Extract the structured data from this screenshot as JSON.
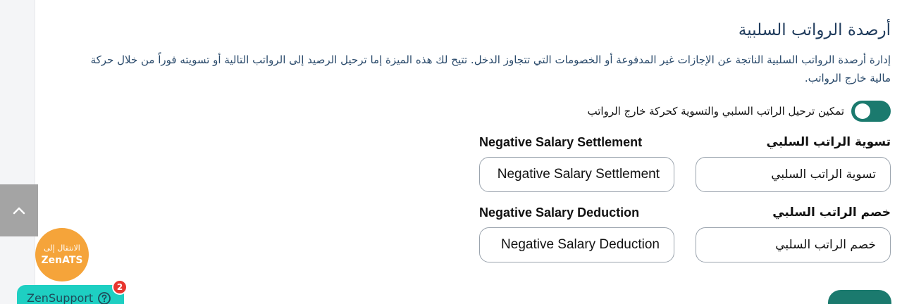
{
  "section": {
    "title": "أرصدة الرواتب السلبية",
    "description": "إدارة أرصدة الرواتب السلبية الناتجة عن الإجازات غير المدفوعة أو الخصومات التي تتجاوز الدخل. تتيح لك هذه الميزة إما ترحيل الرصيد إلى الرواتب التالية أو تسويته فوراً من خلال حركة مالية خارج الرواتب."
  },
  "toggle": {
    "label": "تمكين ترحيل الراتب السلبي والتسوية كحركة خارج الرواتب",
    "enabled": true
  },
  "fields": {
    "settlement": {
      "label_ar": "تسوية الراتب السلبي",
      "label_en": "Negative Salary Settlement",
      "value_ar": "تسوية الراتب السلبي",
      "value_en": "Negative Salary Settlement"
    },
    "deduction": {
      "label_ar": "خصم الراتب السلبي",
      "label_en": "Negative Salary Deduction",
      "value_ar": "خصم الراتب السلبي",
      "value_en": "Negative Salary Deduction"
    }
  },
  "widgets": {
    "zenats_line1": "الانتقال إلى",
    "zenats_line2": "ZenATS",
    "zensupport_label": "ZenSupport",
    "zensupport_badge": "2",
    "scroll_top_icon": "chevron-up-icon",
    "help_icon": "question-circle-icon"
  },
  "colors": {
    "accent": "#1b7a6e",
    "title": "#1f3b5c",
    "zenats": "#f5a43a",
    "zensupport": "#1ecfc2",
    "badge": "#e8352e"
  }
}
